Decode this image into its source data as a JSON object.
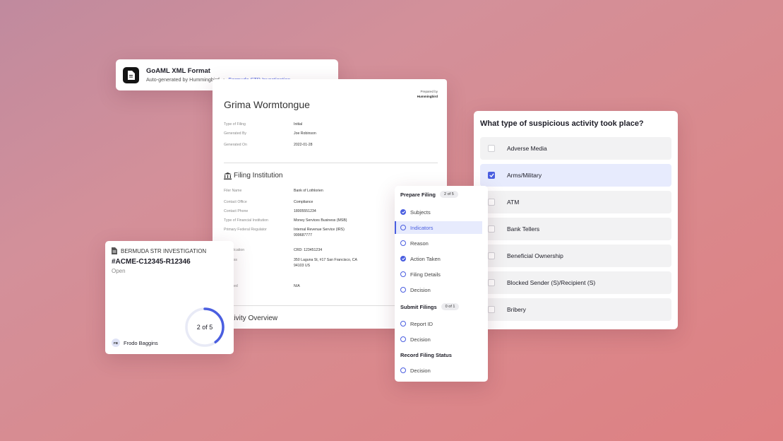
{
  "header": {
    "title": "GoAML XML Format",
    "subtitle": "Auto-generated by Hummingbird",
    "separator": "•",
    "link": "Bermuda STR Investigation"
  },
  "document": {
    "prepared_by": "Prepared by",
    "brand": "Hummingbird",
    "title": "Grima Wormtongue",
    "filing_fields": [
      {
        "k": "Type of Filing",
        "v": "Initial"
      },
      {
        "k": "Generated By",
        "v": "Joe Robinson"
      },
      {
        "k": "Generated On",
        "v": "2022-01-28"
      }
    ],
    "section_institution": "Filing Institution",
    "institution_fields": [
      {
        "k": "Filer Name",
        "v": "Bank of Lothlorien"
      },
      {
        "k": "Contact Office",
        "v": "Compliance"
      },
      {
        "k": "Contact Phone",
        "v": "18005551234"
      },
      {
        "k": "Type of Financial Institution",
        "v": "Money Services Business (MSB)"
      },
      {
        "k": "Primary Federal Regulator",
        "v": "Internal Revenue Service (IRS) 999687777"
      },
      {
        "k": "Identification",
        "v": "CRD: 123451234"
      },
      {
        "k": "Address",
        "v": "350 Laguna St, #17 San Francisco, CA 94103 US"
      },
      {
        "k": "Affiliated",
        "v": "N/A"
      }
    ],
    "section_activity": "Activity Overview"
  },
  "question": {
    "text": "What type of suspicious activity took place?",
    "options": [
      {
        "label": "Adverse Media",
        "checked": false
      },
      {
        "label": "Arms/Military",
        "checked": true
      },
      {
        "label": "ATM",
        "checked": false
      },
      {
        "label": "Bank Tellers",
        "checked": false
      },
      {
        "label": "Beneficial Ownership",
        "checked": false
      },
      {
        "label": "Blocked Sender (S)/Recipient (S)",
        "checked": false
      },
      {
        "label": "Bribery",
        "checked": false
      }
    ]
  },
  "steps": {
    "prepare": {
      "title": "Prepare Filing",
      "badge": "2 of 5"
    },
    "prepare_items": [
      "Subjects",
      "Indicators",
      "Reason",
      "Action Taken",
      "Filing Details",
      "Decision"
    ],
    "submit": {
      "title": "Submit Filings",
      "badge": "0 of 1"
    },
    "submit_items": [
      "Report ID",
      "Decision"
    ],
    "record": {
      "title": "Record Filing Status"
    },
    "record_items": [
      "Decision"
    ]
  },
  "case": {
    "label": "BERMUDA STR INVESTIGATION",
    "id": "#ACME-C12345-R12346",
    "status": "Open",
    "progress_text": "2 of 5",
    "progress_fraction": 0.4,
    "user_initials": "FB",
    "user_name": "Frodo Baggins"
  },
  "colors": {
    "accent": "#4a5ee0",
    "background": "#d98a8e"
  }
}
